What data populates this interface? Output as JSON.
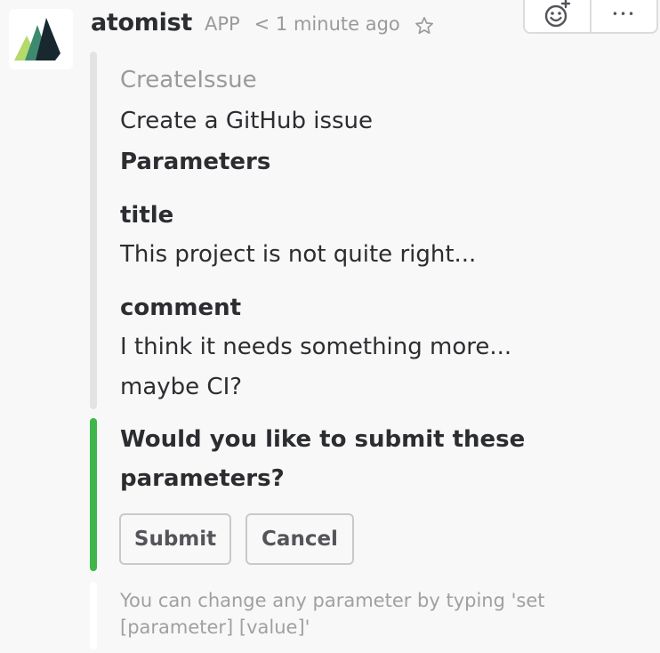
{
  "message": {
    "sender": "atomist",
    "badge": "APP",
    "timestamp": "< 1 minute ago",
    "avatar_icon": "atomist-logo",
    "star_icon": "star-icon"
  },
  "actions": {
    "reaction_icon": "add-reaction-icon",
    "more_label": "•••"
  },
  "attachment": {
    "pretext": "CreateIssue",
    "text": "Create a GitHub issue",
    "params_heading": "Parameters",
    "fields": [
      {
        "title": "title",
        "value": "This project is not quite right..."
      },
      {
        "title": "comment",
        "value_line1": "I think it needs something more...",
        "value_line2": "maybe CI?"
      }
    ]
  },
  "confirm": {
    "question_line1": "Would you like to submit these",
    "question_line2": "parameters?",
    "submit_label": "Submit",
    "cancel_label": "Cancel",
    "accent_color": "#3eb64a"
  },
  "footer": {
    "line1": "You can change any parameter by typing 'set",
    "line2": "[parameter] [value]'"
  }
}
